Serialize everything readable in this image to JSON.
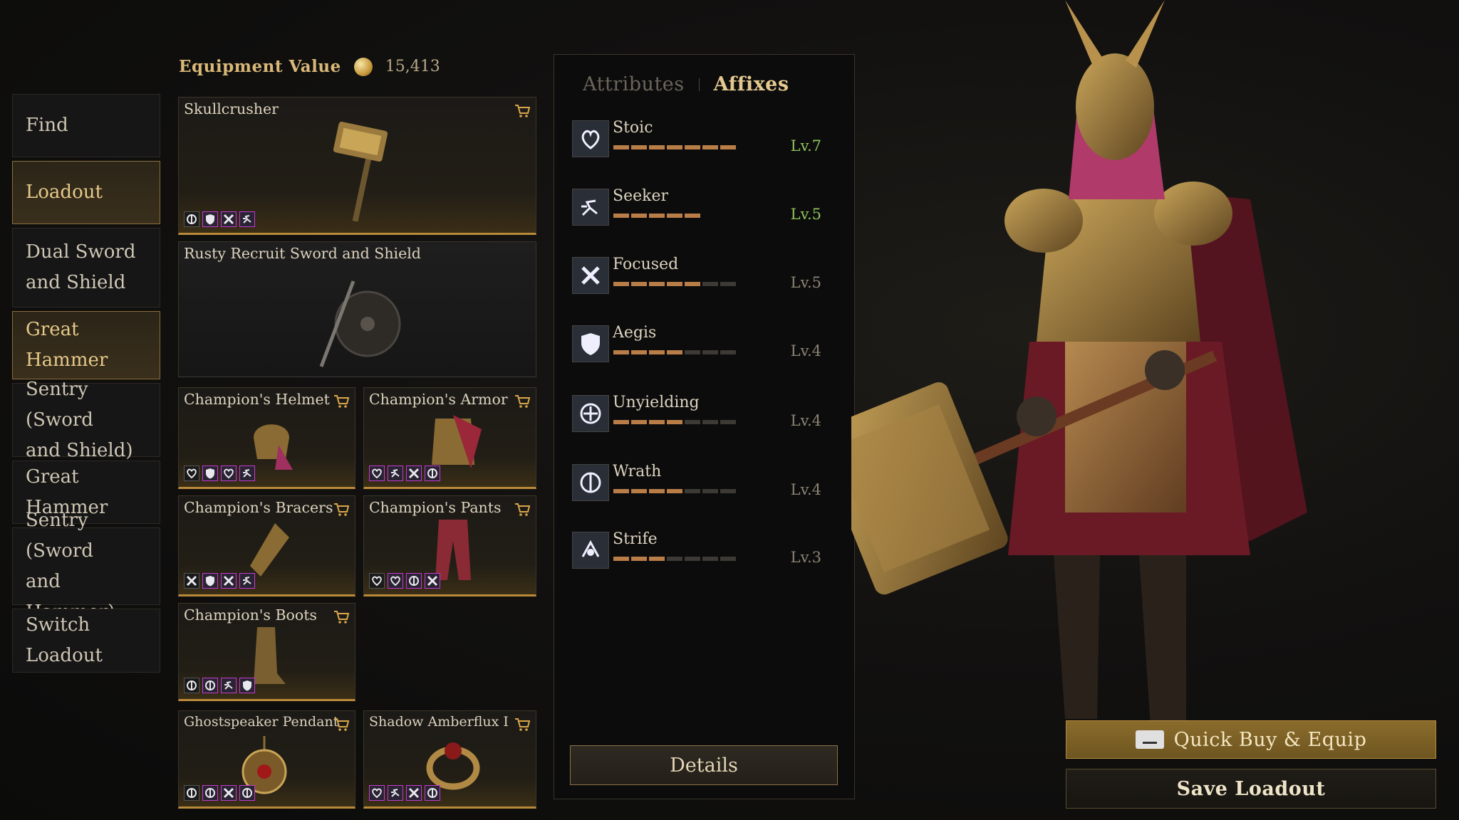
{
  "nav": {
    "items": [
      {
        "label": "Find",
        "active": false
      },
      {
        "label": "Loadout",
        "active": true
      },
      {
        "label": "Dual Sword\nand Shield",
        "active": false
      },
      {
        "label": "Great Hammer",
        "active": true
      },
      {
        "label": "Sentry (Sword\nand Shield)",
        "active": false
      },
      {
        "label": "Great Hammer",
        "active": false
      },
      {
        "label": "Sentry (Sword\nand Hammer)",
        "active": false
      },
      {
        "label": "Switch Loadout",
        "active": false
      }
    ]
  },
  "equipment": {
    "label": "Equipment Value",
    "value": "15,413",
    "items": [
      {
        "name": "Skullcrusher"
      },
      {
        "name": "Rusty Recruit Sword and Shield"
      },
      {
        "name": "Champion's Helmet"
      },
      {
        "name": "Champion's Armor"
      },
      {
        "name": "Champion's Bracers"
      },
      {
        "name": "Champion's Pants"
      },
      {
        "name": "Champion's Boots"
      },
      {
        "name": "Ghostspeaker Pendant"
      },
      {
        "name": "Shadow Amberflux I"
      }
    ]
  },
  "panel": {
    "tabs": [
      {
        "label": "Attributes",
        "active": false
      },
      {
        "label": "Affixes",
        "active": true
      }
    ],
    "affixes": [
      {
        "name": "Stoic",
        "level": "Lv.7",
        "filled": 7,
        "total": 7,
        "maxed": true,
        "icon": "stoic-icon"
      },
      {
        "name": "Seeker",
        "level": "Lv.5",
        "filled": 5,
        "total": 5,
        "maxed": true,
        "icon": "seeker-icon"
      },
      {
        "name": "Focused",
        "level": "Lv.5",
        "filled": 5,
        "total": 7,
        "maxed": false,
        "icon": "focused-icon"
      },
      {
        "name": "Aegis",
        "level": "Lv.4",
        "filled": 4,
        "total": 7,
        "maxed": false,
        "icon": "aegis-icon"
      },
      {
        "name": "Unyielding",
        "level": "Lv.4",
        "filled": 4,
        "total": 7,
        "maxed": false,
        "icon": "unyielding-icon"
      },
      {
        "name": "Wrath",
        "level": "Lv.4",
        "filled": 4,
        "total": 7,
        "maxed": false,
        "icon": "wrath-icon"
      },
      {
        "name": "Strife",
        "level": "Lv.3",
        "filled": 3,
        "total": 7,
        "maxed": false,
        "icon": "strife-icon"
      }
    ],
    "details_label": "Details"
  },
  "actions": {
    "quick_buy_label": "Quick Buy & Equip",
    "save_label": "Save Loadout"
  },
  "colors": {
    "accent_gold": "#d9b878",
    "level_maxed": "#8ec35a",
    "affix_border": "#c23ad6"
  }
}
